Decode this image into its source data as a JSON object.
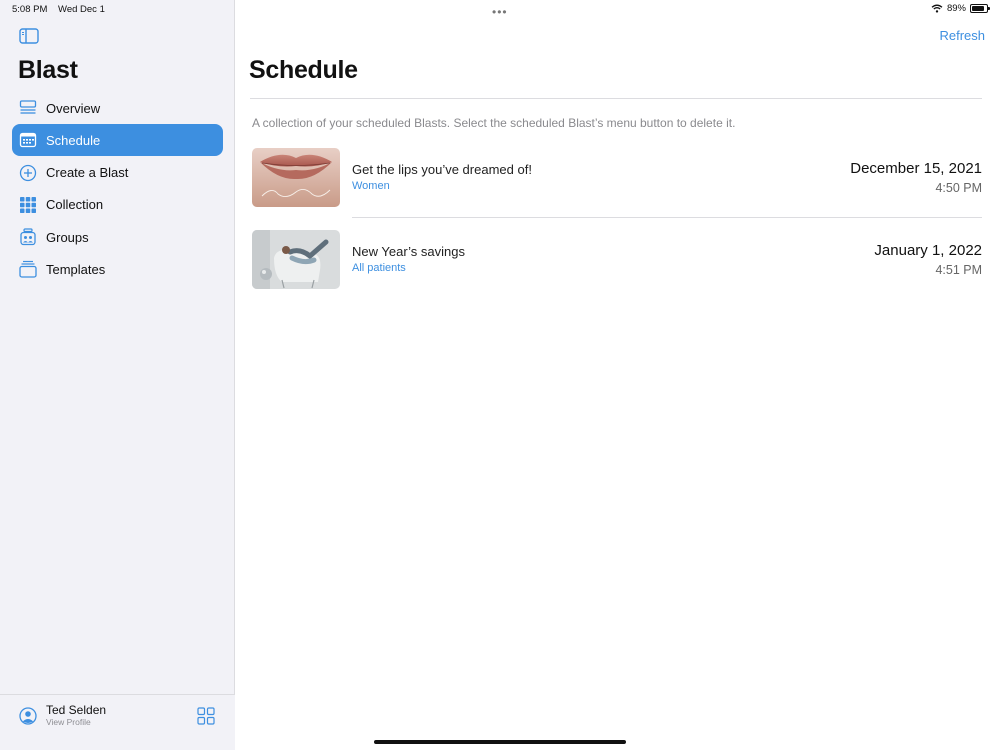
{
  "status_bar": {
    "time": "5:08 PM",
    "date": "Wed Dec 1",
    "battery": "89%",
    "battery_level": 0.89,
    "multitask_dots": "•••"
  },
  "sidebar": {
    "app_title": "Blast",
    "items": [
      {
        "label": "Overview",
        "icon": "overview-icon",
        "active": false
      },
      {
        "label": "Schedule",
        "icon": "calendar-icon",
        "active": true
      },
      {
        "label": "Create a Blast",
        "icon": "plus-circle-icon",
        "active": false
      },
      {
        "label": "Collection",
        "icon": "grid-icon",
        "active": false
      },
      {
        "label": "Groups",
        "icon": "groups-icon",
        "active": false
      },
      {
        "label": "Templates",
        "icon": "templates-icon",
        "active": false
      }
    ],
    "profile": {
      "name": "Ted Selden",
      "subtitle": "View Profile"
    }
  },
  "main": {
    "refresh_label": "Refresh",
    "page_title": "Schedule",
    "description": "A collection of your scheduled Blasts. Select the scheduled Blast’s menu button to delete it.",
    "scheduled": [
      {
        "title": "Get the lips you’ve dreamed of!",
        "group": "Women",
        "date": "December 15, 2021",
        "time": "4:50 PM",
        "thumbnail": "lips-photo"
      },
      {
        "title": "New Year’s savings",
        "group": "All patients",
        "date": "January 1, 2022",
        "time": "4:51 PM",
        "thumbnail": "woman-chair-photo"
      }
    ]
  },
  "colors": {
    "accent": "#3d8fe0",
    "sidebar_bg": "#f2f2f7",
    "divider": "#dcdce0"
  }
}
